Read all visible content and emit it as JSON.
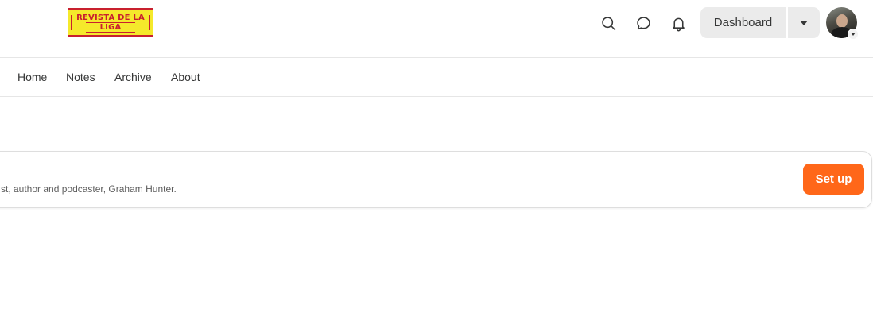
{
  "header": {
    "logo": {
      "line1": "REVISTA DE LA",
      "line2": "LIGA",
      "alt": "Revista de La Liga logo"
    },
    "icons": [
      "search-icon",
      "chat-icon",
      "bell-icon"
    ],
    "dashboard_label": "Dashboard",
    "avatar_alt": "User avatar"
  },
  "nav": {
    "items": [
      {
        "label": "Home"
      },
      {
        "label": "Notes"
      },
      {
        "label": "Archive"
      },
      {
        "label": "About"
      }
    ]
  },
  "banner": {
    "text": "st, author and podcaster, Graham Hunter.",
    "button_label": "Set up"
  },
  "colors": {
    "accent": "#ff6719",
    "logo_yellow": "#f5e92b",
    "logo_red": "#c8202e",
    "button_gray": "#ebebeb"
  }
}
